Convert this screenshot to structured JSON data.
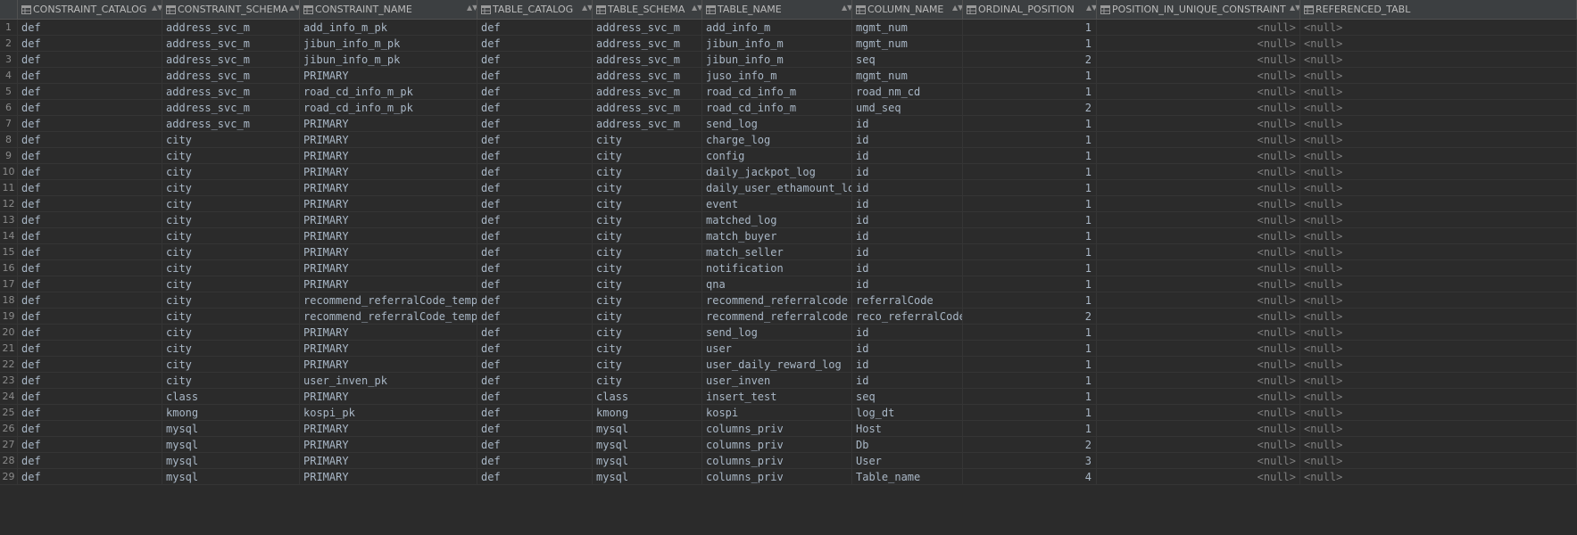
{
  "columns": [
    {
      "name": "CONSTRAINT_CATALOG"
    },
    {
      "name": "CONSTRAINT_SCHEMA"
    },
    {
      "name": "CONSTRAINT_NAME"
    },
    {
      "name": "TABLE_CATALOG"
    },
    {
      "name": "TABLE_SCHEMA"
    },
    {
      "name": "TABLE_NAME"
    },
    {
      "name": "COLUMN_NAME"
    },
    {
      "name": "ORDINAL_POSITION"
    },
    {
      "name": "POSITION_IN_UNIQUE_CONSTRAINT"
    },
    {
      "name": "REFERENCED_TABL"
    }
  ],
  "rows": [
    {
      "n": "1",
      "cc": "def",
      "cs": "address_svc_m",
      "cn": "add_info_m_pk",
      "tc": "def",
      "ts": "address_svc_m",
      "tn": "add_info_m",
      "col": "mgmt_num",
      "op": "1",
      "pu": "<null>",
      "rt": "<null>"
    },
    {
      "n": "2",
      "cc": "def",
      "cs": "address_svc_m",
      "cn": "jibun_info_m_pk",
      "tc": "def",
      "ts": "address_svc_m",
      "tn": "jibun_info_m",
      "col": "mgmt_num",
      "op": "1",
      "pu": "<null>",
      "rt": "<null>"
    },
    {
      "n": "3",
      "cc": "def",
      "cs": "address_svc_m",
      "cn": "jibun_info_m_pk",
      "tc": "def",
      "ts": "address_svc_m",
      "tn": "jibun_info_m",
      "col": "seq",
      "op": "2",
      "pu": "<null>",
      "rt": "<null>"
    },
    {
      "n": "4",
      "cc": "def",
      "cs": "address_svc_m",
      "cn": "PRIMARY",
      "tc": "def",
      "ts": "address_svc_m",
      "tn": "juso_info_m",
      "col": "mgmt_num",
      "op": "1",
      "pu": "<null>",
      "rt": "<null>"
    },
    {
      "n": "5",
      "cc": "def",
      "cs": "address_svc_m",
      "cn": "road_cd_info_m_pk",
      "tc": "def",
      "ts": "address_svc_m",
      "tn": "road_cd_info_m",
      "col": "road_nm_cd",
      "op": "1",
      "pu": "<null>",
      "rt": "<null>"
    },
    {
      "n": "6",
      "cc": "def",
      "cs": "address_svc_m",
      "cn": "road_cd_info_m_pk",
      "tc": "def",
      "ts": "address_svc_m",
      "tn": "road_cd_info_m",
      "col": "umd_seq",
      "op": "2",
      "pu": "<null>",
      "rt": "<null>"
    },
    {
      "n": "7",
      "cc": "def",
      "cs": "address_svc_m",
      "cn": "PRIMARY",
      "tc": "def",
      "ts": "address_svc_m",
      "tn": "send_log",
      "col": "id",
      "op": "1",
      "pu": "<null>",
      "rt": "<null>"
    },
    {
      "n": "8",
      "cc": "def",
      "cs": "city",
      "cn": "PRIMARY",
      "tc": "def",
      "ts": "city",
      "tn": "charge_log",
      "col": "id",
      "op": "1",
      "pu": "<null>",
      "rt": "<null>"
    },
    {
      "n": "9",
      "cc": "def",
      "cs": "city",
      "cn": "PRIMARY",
      "tc": "def",
      "ts": "city",
      "tn": "config",
      "col": "id",
      "op": "1",
      "pu": "<null>",
      "rt": "<null>"
    },
    {
      "n": "10",
      "cc": "def",
      "cs": "city",
      "cn": "PRIMARY",
      "tc": "def",
      "ts": "city",
      "tn": "daily_jackpot_log",
      "col": "id",
      "op": "1",
      "pu": "<null>",
      "rt": "<null>"
    },
    {
      "n": "11",
      "cc": "def",
      "cs": "city",
      "cn": "PRIMARY",
      "tc": "def",
      "ts": "city",
      "tn": "daily_user_ethamount_log",
      "col": "id",
      "op": "1",
      "pu": "<null>",
      "rt": "<null>"
    },
    {
      "n": "12",
      "cc": "def",
      "cs": "city",
      "cn": "PRIMARY",
      "tc": "def",
      "ts": "city",
      "tn": "event",
      "col": "id",
      "op": "1",
      "pu": "<null>",
      "rt": "<null>"
    },
    {
      "n": "13",
      "cc": "def",
      "cs": "city",
      "cn": "PRIMARY",
      "tc": "def",
      "ts": "city",
      "tn": "matched_log",
      "col": "id",
      "op": "1",
      "pu": "<null>",
      "rt": "<null>"
    },
    {
      "n": "14",
      "cc": "def",
      "cs": "city",
      "cn": "PRIMARY",
      "tc": "def",
      "ts": "city",
      "tn": "match_buyer",
      "col": "id",
      "op": "1",
      "pu": "<null>",
      "rt": "<null>"
    },
    {
      "n": "15",
      "cc": "def",
      "cs": "city",
      "cn": "PRIMARY",
      "tc": "def",
      "ts": "city",
      "tn": "match_seller",
      "col": "id",
      "op": "1",
      "pu": "<null>",
      "rt": "<null>"
    },
    {
      "n": "16",
      "cc": "def",
      "cs": "city",
      "cn": "PRIMARY",
      "tc": "def",
      "ts": "city",
      "tn": "notification",
      "col": "id",
      "op": "1",
      "pu": "<null>",
      "rt": "<null>"
    },
    {
      "n": "17",
      "cc": "def",
      "cs": "city",
      "cn": "PRIMARY",
      "tc": "def",
      "ts": "city",
      "tn": "qna",
      "col": "id",
      "op": "1",
      "pu": "<null>",
      "rt": "<null>"
    },
    {
      "n": "18",
      "cc": "def",
      "cs": "city",
      "cn": "recommend_referralCode_temp_pk",
      "tc": "def",
      "ts": "city",
      "tn": "recommend_referralcode",
      "col": "referralCode",
      "op": "1",
      "pu": "<null>",
      "rt": "<null>"
    },
    {
      "n": "19",
      "cc": "def",
      "cs": "city",
      "cn": "recommend_referralCode_temp_pk",
      "tc": "def",
      "ts": "city",
      "tn": "recommend_referralcode",
      "col": "reco_referralCode",
      "op": "2",
      "pu": "<null>",
      "rt": "<null>"
    },
    {
      "n": "20",
      "cc": "def",
      "cs": "city",
      "cn": "PRIMARY",
      "tc": "def",
      "ts": "city",
      "tn": "send_log",
      "col": "id",
      "op": "1",
      "pu": "<null>",
      "rt": "<null>"
    },
    {
      "n": "21",
      "cc": "def",
      "cs": "city",
      "cn": "PRIMARY",
      "tc": "def",
      "ts": "city",
      "tn": "user",
      "col": "id",
      "op": "1",
      "pu": "<null>",
      "rt": "<null>"
    },
    {
      "n": "22",
      "cc": "def",
      "cs": "city",
      "cn": "PRIMARY",
      "tc": "def",
      "ts": "city",
      "tn": "user_daily_reward_log",
      "col": "id",
      "op": "1",
      "pu": "<null>",
      "rt": "<null>"
    },
    {
      "n": "23",
      "cc": "def",
      "cs": "city",
      "cn": "user_inven_pk",
      "tc": "def",
      "ts": "city",
      "tn": "user_inven",
      "col": "id",
      "op": "1",
      "pu": "<null>",
      "rt": "<null>"
    },
    {
      "n": "24",
      "cc": "def",
      "cs": "class",
      "cn": "PRIMARY",
      "tc": "def",
      "ts": "class",
      "tn": "insert_test",
      "col": "seq",
      "op": "1",
      "pu": "<null>",
      "rt": "<null>"
    },
    {
      "n": "25",
      "cc": "def",
      "cs": "kmong",
      "cn": "kospi_pk",
      "tc": "def",
      "ts": "kmong",
      "tn": "kospi",
      "col": "log_dt",
      "op": "1",
      "pu": "<null>",
      "rt": "<null>"
    },
    {
      "n": "26",
      "cc": "def",
      "cs": "mysql",
      "cn": "PRIMARY",
      "tc": "def",
      "ts": "mysql",
      "tn": "columns_priv",
      "col": "Host",
      "op": "1",
      "pu": "<null>",
      "rt": "<null>"
    },
    {
      "n": "27",
      "cc": "def",
      "cs": "mysql",
      "cn": "PRIMARY",
      "tc": "def",
      "ts": "mysql",
      "tn": "columns_priv",
      "col": "Db",
      "op": "2",
      "pu": "<null>",
      "rt": "<null>"
    },
    {
      "n": "28",
      "cc": "def",
      "cs": "mysql",
      "cn": "PRIMARY",
      "tc": "def",
      "ts": "mysql",
      "tn": "columns_priv",
      "col": "User",
      "op": "3",
      "pu": "<null>",
      "rt": "<null>"
    },
    {
      "n": "29",
      "cc": "def",
      "cs": "mysql",
      "cn": "PRIMARY",
      "tc": "def",
      "ts": "mysql",
      "tn": "columns_priv",
      "col": "Table_name",
      "op": "4",
      "pu": "<null>",
      "rt": "<null>"
    }
  ],
  "colors": {
    "background": "#2b2b2b",
    "header_background": "#3c3f41",
    "text": "#a9b7c6",
    "null_text": "#7f7f7f"
  },
  "icons": {
    "column_icon": "table-column-icon",
    "sort_icon": "sort-arrows-icon"
  }
}
